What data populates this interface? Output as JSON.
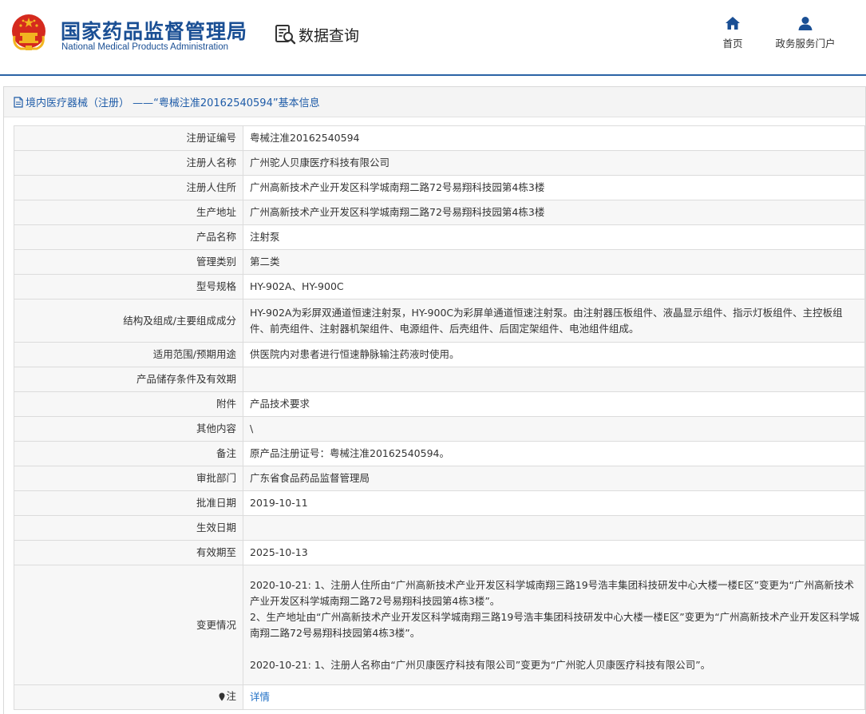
{
  "header": {
    "org_cn": "国家药品监督管理局",
    "org_en": "National Medical Products Administration",
    "section_label": "数据查询",
    "nav": [
      {
        "label": "首页",
        "icon": "home-icon"
      },
      {
        "label": "政务服务门户",
        "icon": "user-icon"
      }
    ]
  },
  "panel": {
    "title": "境内医疗器械（注册） ——“粤械注准20162540594”基本信息"
  },
  "rows": [
    {
      "key": "注册证编号",
      "value": "粤械注准20162540594"
    },
    {
      "key": "注册人名称",
      "value": "广州驼人贝康医疗科技有限公司"
    },
    {
      "key": "注册人住所",
      "value": "广州高新技术产业开发区科学城南翔二路72号易翔科技园第4栋3楼"
    },
    {
      "key": "生产地址",
      "value": "广州高新技术产业开发区科学城南翔二路72号易翔科技园第4栋3楼"
    },
    {
      "key": "产品名称",
      "value": "注射泵"
    },
    {
      "key": "管理类别",
      "value": "第二类"
    },
    {
      "key": "型号规格",
      "value": "HY-902A、HY-900C"
    },
    {
      "key": "结构及组成/主要组成成分",
      "value": "HY-902A为彩屏双通道恒速注射泵，HY-900C为彩屏单通道恒速注射泵。由注射器压板组件、液晶显示组件、指示灯板组件、主控板组件、前壳组件、注射器机架组件、电源组件、后壳组件、后固定架组件、电池组件组成。"
    },
    {
      "key": "适用范围/预期用途",
      "value": "供医院内对患者进行恒速静脉输注药液时使用。"
    },
    {
      "key": "产品储存条件及有效期",
      "value": ""
    },
    {
      "key": "附件",
      "value": "产品技术要求"
    },
    {
      "key": "其他内容",
      "value": "\\"
    },
    {
      "key": "备注",
      "value": "原产品注册证号：粤械注准20162540594。"
    },
    {
      "key": "审批部门",
      "value": "广东省食品药品监督管理局"
    },
    {
      "key": "批准日期",
      "value": "2019-10-11"
    },
    {
      "key": "生效日期",
      "value": ""
    },
    {
      "key": "有效期至",
      "value": "2025-10-13"
    },
    {
      "key": "变更情况",
      "value": "2020-10-21: 1、注册人住所由“广州高新技术产业开发区科学城南翔三路19号浩丰集团科技研发中心大楼一楼E区”变更为“广州高新技术产业开发区科学城南翔二路72号易翔科技园第4栋3楼”。\n2、生产地址由“广州高新技术产业开发区科学城南翔三路19号浩丰集团科技研发中心大楼一楼E区”变更为“广州高新技术产业开发区科学城南翔二路72号易翔科技园第4栋3楼”。\n\n2020-10-21: 1、注册人名称由“广州贝康医疗科技有限公司”变更为“广州驼人贝康医疗科技有限公司”。"
    }
  ],
  "note": {
    "key": "注",
    "link_label": "详情"
  },
  "colors": {
    "brand_blue": "#1a4f94",
    "link_blue": "#1f6fc5",
    "emblem_red": "#d52a1e",
    "emblem_gold": "#f2b520"
  }
}
